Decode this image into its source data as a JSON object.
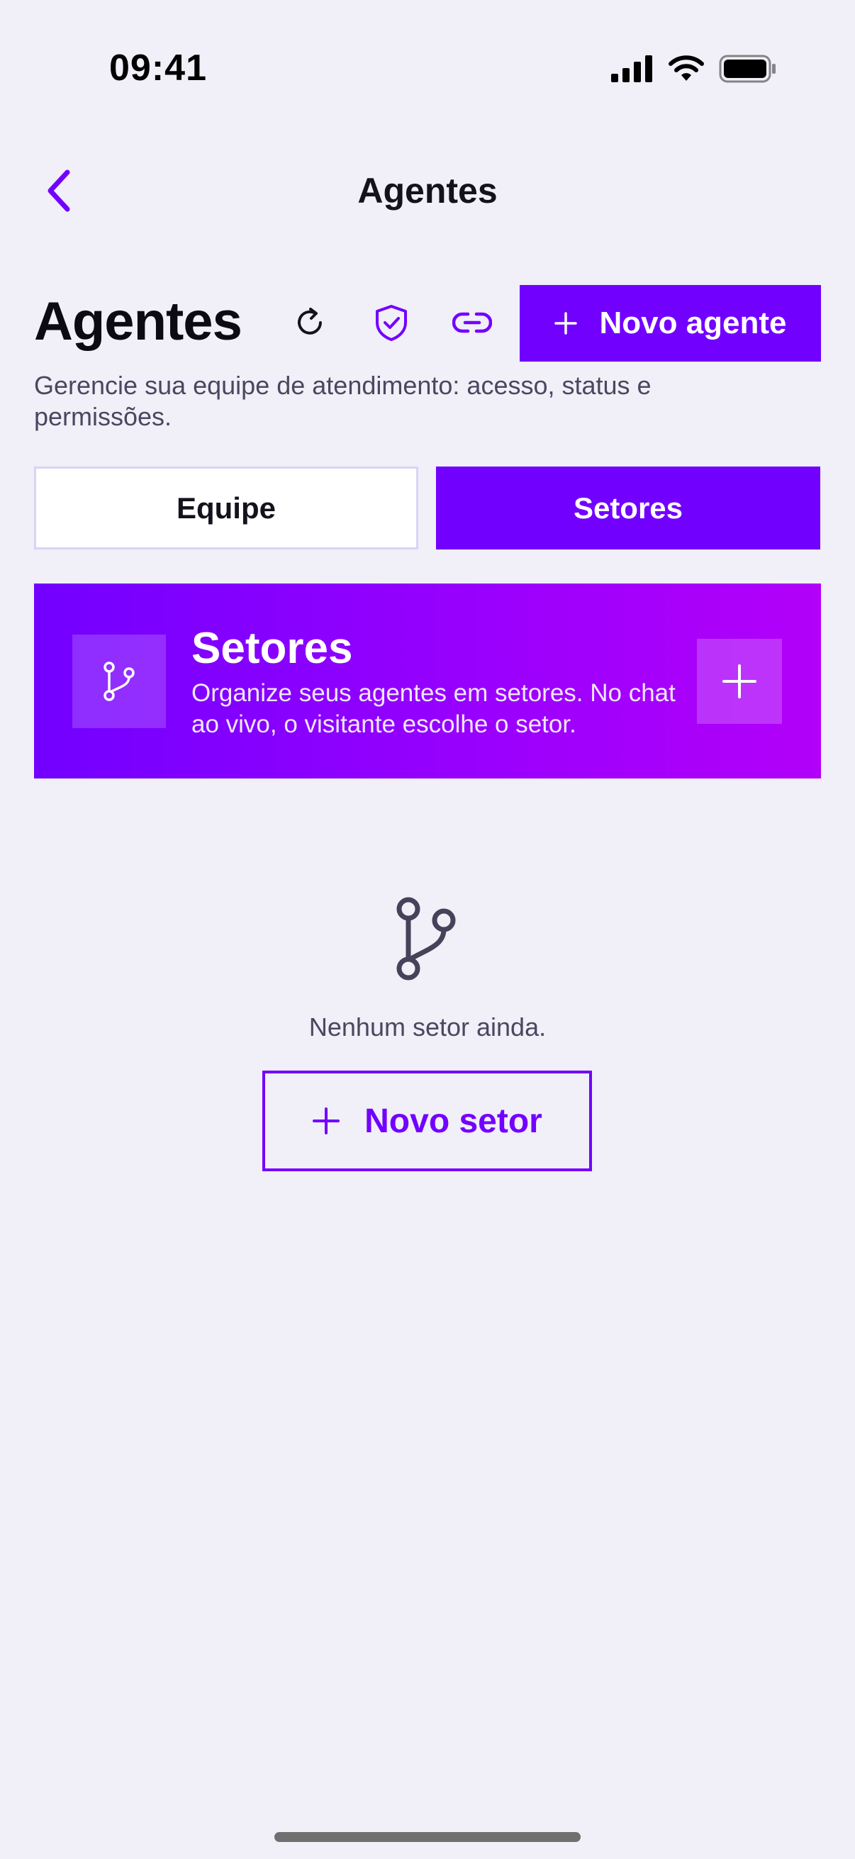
{
  "status_bar": {
    "time": "09:41",
    "icons": [
      "signal-icon",
      "wifi-icon",
      "battery-icon"
    ]
  },
  "nav": {
    "back_icon": "chevron-left-icon",
    "title": "Agentes"
  },
  "header": {
    "title": "Agentes",
    "actions": [
      "refresh-icon",
      "shield-check-icon",
      "link-icon"
    ],
    "new_agent_label": "Novo agente",
    "subtitle": "Gerencie sua equipe de atendimento: acesso, status e permissões."
  },
  "tabs": [
    {
      "label": "Equipe",
      "selected": false
    },
    {
      "label": "Setores",
      "selected": true
    }
  ],
  "banner": {
    "icon": "git-branch-icon",
    "title": "Setores",
    "description": "Organize seus agentes em setores. No chat ao vivo, o visitante escolhe o setor.",
    "add_icon": "plus-icon"
  },
  "empty_state": {
    "icon": "git-branch-icon",
    "message": "Nenhum setor ainda.",
    "button_label": "Novo setor"
  },
  "colors": {
    "accent": "#7200ff",
    "background": "#f1eff7",
    "gradient_end": "#b200f9",
    "muted_text": "#4a4760"
  }
}
